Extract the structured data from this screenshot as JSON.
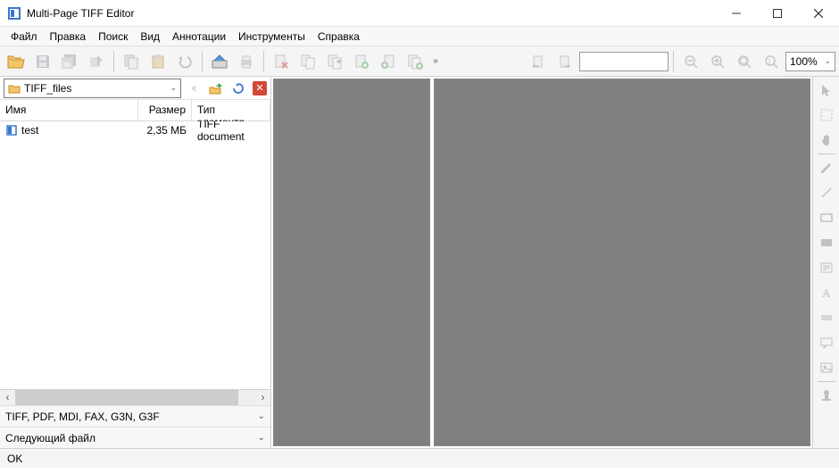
{
  "window": {
    "title": "Multi-Page TIFF Editor"
  },
  "menu": {
    "file": "Файл",
    "edit": "Правка",
    "search": "Поиск",
    "view": "Вид",
    "annotations": "Аннотации",
    "tools": "Инструменты",
    "help": "Справка"
  },
  "toolbar": {
    "zoom_value": "100%"
  },
  "nav": {
    "path": "TIFF_files"
  },
  "filelist": {
    "col_name": "Имя",
    "col_size": "Размер",
    "col_type": "Тип элемента",
    "rows": [
      {
        "name": "test",
        "size": "2,35 МБ",
        "type": "TIFF document"
      }
    ]
  },
  "filter": {
    "label": "TIFF, PDF, MDI, FAX, G3N, G3F"
  },
  "next": {
    "label": "Следующий файл"
  },
  "status": {
    "text": "OK"
  }
}
